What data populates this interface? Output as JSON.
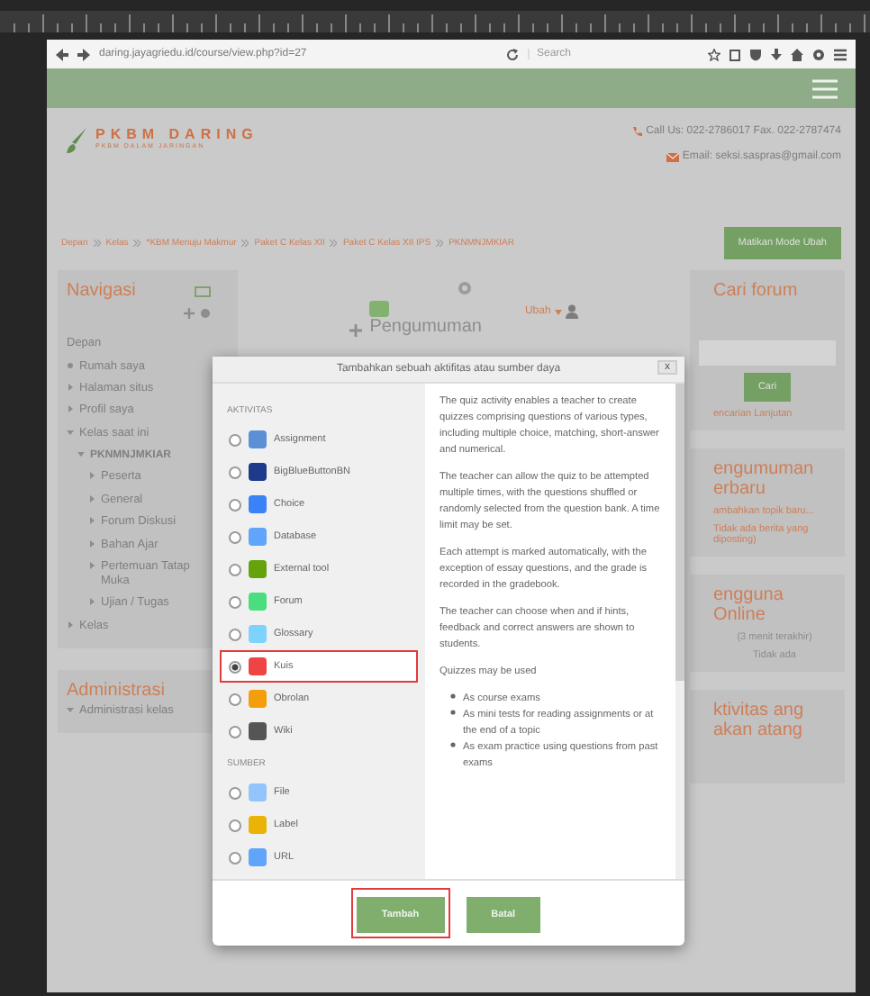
{
  "browser": {
    "url": "daring.jayagriedu.id/course/view.php?id=27",
    "search_placeholder": "Search"
  },
  "header": {
    "logo_title": "PKBM DARING",
    "logo_subtitle": "PKBM DALAM JARINGAN",
    "call": "Call Us: 022-2786017 Fax. 022-2787474",
    "email": "Email: seksi.saspras@gmail.com"
  },
  "breadcrumb": [
    "Depan",
    "Kelas",
    "*KBM Menuju Makmur",
    "Paket C Kelas XII",
    "Paket C Kelas XII IPS",
    "PKNMNJMKIAR"
  ],
  "edit_button": "Matikan Mode Ubah",
  "navigation": {
    "title": "Navigasi",
    "items": [
      {
        "label": "Depan",
        "kind": "plain"
      },
      {
        "label": "Rumah saya",
        "kind": "leaf"
      },
      {
        "label": "Halaman situs",
        "kind": "branch",
        "expanded": false
      },
      {
        "label": "Profil saya",
        "kind": "branch",
        "expanded": false
      },
      {
        "label": "Kelas saat ini",
        "kind": "branch",
        "expanded": true,
        "children": [
          {
            "label": "PKNMNJMKIAR",
            "kind": "branch",
            "expanded": true,
            "children": [
              {
                "label": "Peserta",
                "kind": "branch",
                "expanded": false
              },
              {
                "label": "General",
                "kind": "branch",
                "expanded": false
              },
              {
                "label": "Forum Diskusi",
                "kind": "branch",
                "expanded": false
              },
              {
                "label": "Bahan Ajar",
                "kind": "branch",
                "expanded": false
              },
              {
                "label": "Pertemuan Tatap Muka",
                "kind": "branch",
                "expanded": false
              },
              {
                "label": "Ujian / Tugas",
                "kind": "branch",
                "expanded": false
              }
            ]
          }
        ]
      },
      {
        "label": "Kelas",
        "kind": "branch",
        "expanded": false
      }
    ]
  },
  "administration": {
    "title": "Administrasi",
    "items": [
      {
        "label": "Administrasi kelas",
        "kind": "branch",
        "expanded": true
      }
    ]
  },
  "center": {
    "section_title": "Pengumuman",
    "edit_menu": "Ubah"
  },
  "right": {
    "search_title": "Cari forum",
    "search_button": "Cari",
    "advanced": "encarian Lanjutan",
    "news_title": "engumuman erbaru",
    "news_add": "ambahkan topik baru...",
    "news_empty": "Tidak ada berita yang diposting)",
    "online_title": "engguna Online",
    "online_period": "(3 menit terakhir)",
    "online_none": "Tidak ada",
    "upcoming_title": "ktivitas ang akan atang"
  },
  "modal": {
    "title": "Tambahkan sebuah aktifitas atau sumber daya",
    "close": "x",
    "sections": [
      {
        "heading": "AKTIVITAS",
        "options": [
          {
            "label": "Assignment",
            "selected": false,
            "highlighted": false
          },
          {
            "label": "BigBlueButtonBN",
            "selected": false,
            "highlighted": false
          },
          {
            "label": "Choice",
            "selected": false,
            "highlighted": false
          },
          {
            "label": "Database",
            "selected": false,
            "highlighted": false
          },
          {
            "label": "External tool",
            "selected": false,
            "highlighted": false
          },
          {
            "label": "Forum",
            "selected": false,
            "highlighted": false
          },
          {
            "label": "Glossary",
            "selected": false,
            "highlighted": false
          },
          {
            "label": "Kuis",
            "selected": true,
            "highlighted": true
          },
          {
            "label": "Obrolan",
            "selected": false,
            "highlighted": false
          },
          {
            "label": "Wiki",
            "selected": false,
            "highlighted": false
          }
        ]
      },
      {
        "heading": "SUMBER",
        "options": [
          {
            "label": "File",
            "selected": false,
            "highlighted": false
          },
          {
            "label": "Label",
            "selected": false,
            "highlighted": false
          },
          {
            "label": "URL",
            "selected": false,
            "highlighted": false
          }
        ]
      }
    ],
    "description": [
      "The quiz activity enables a teacher to create quizzes comprising questions of various types, including multiple choice, matching, short-answer and numerical.",
      "The teacher can allow the quiz to be attempted multiple times, with the questions shuffled or randomly selected from the question bank. A time limit may be set.",
      "Each attempt is marked automatically, with the exception of essay questions, and the grade is recorded in the gradebook.",
      "The teacher can choose when and if hints, feedback and correct answers are shown to students.",
      "Quizzes may be used"
    ],
    "bullets": [
      "As course exams",
      "As mini tests for reading assignments or at the end of a topic",
      "As exam practice using questions from past exams"
    ],
    "buttons": [
      {
        "label": "Tambah",
        "highlighted": true
      },
      {
        "label": "Batal",
        "highlighted": false
      }
    ]
  }
}
